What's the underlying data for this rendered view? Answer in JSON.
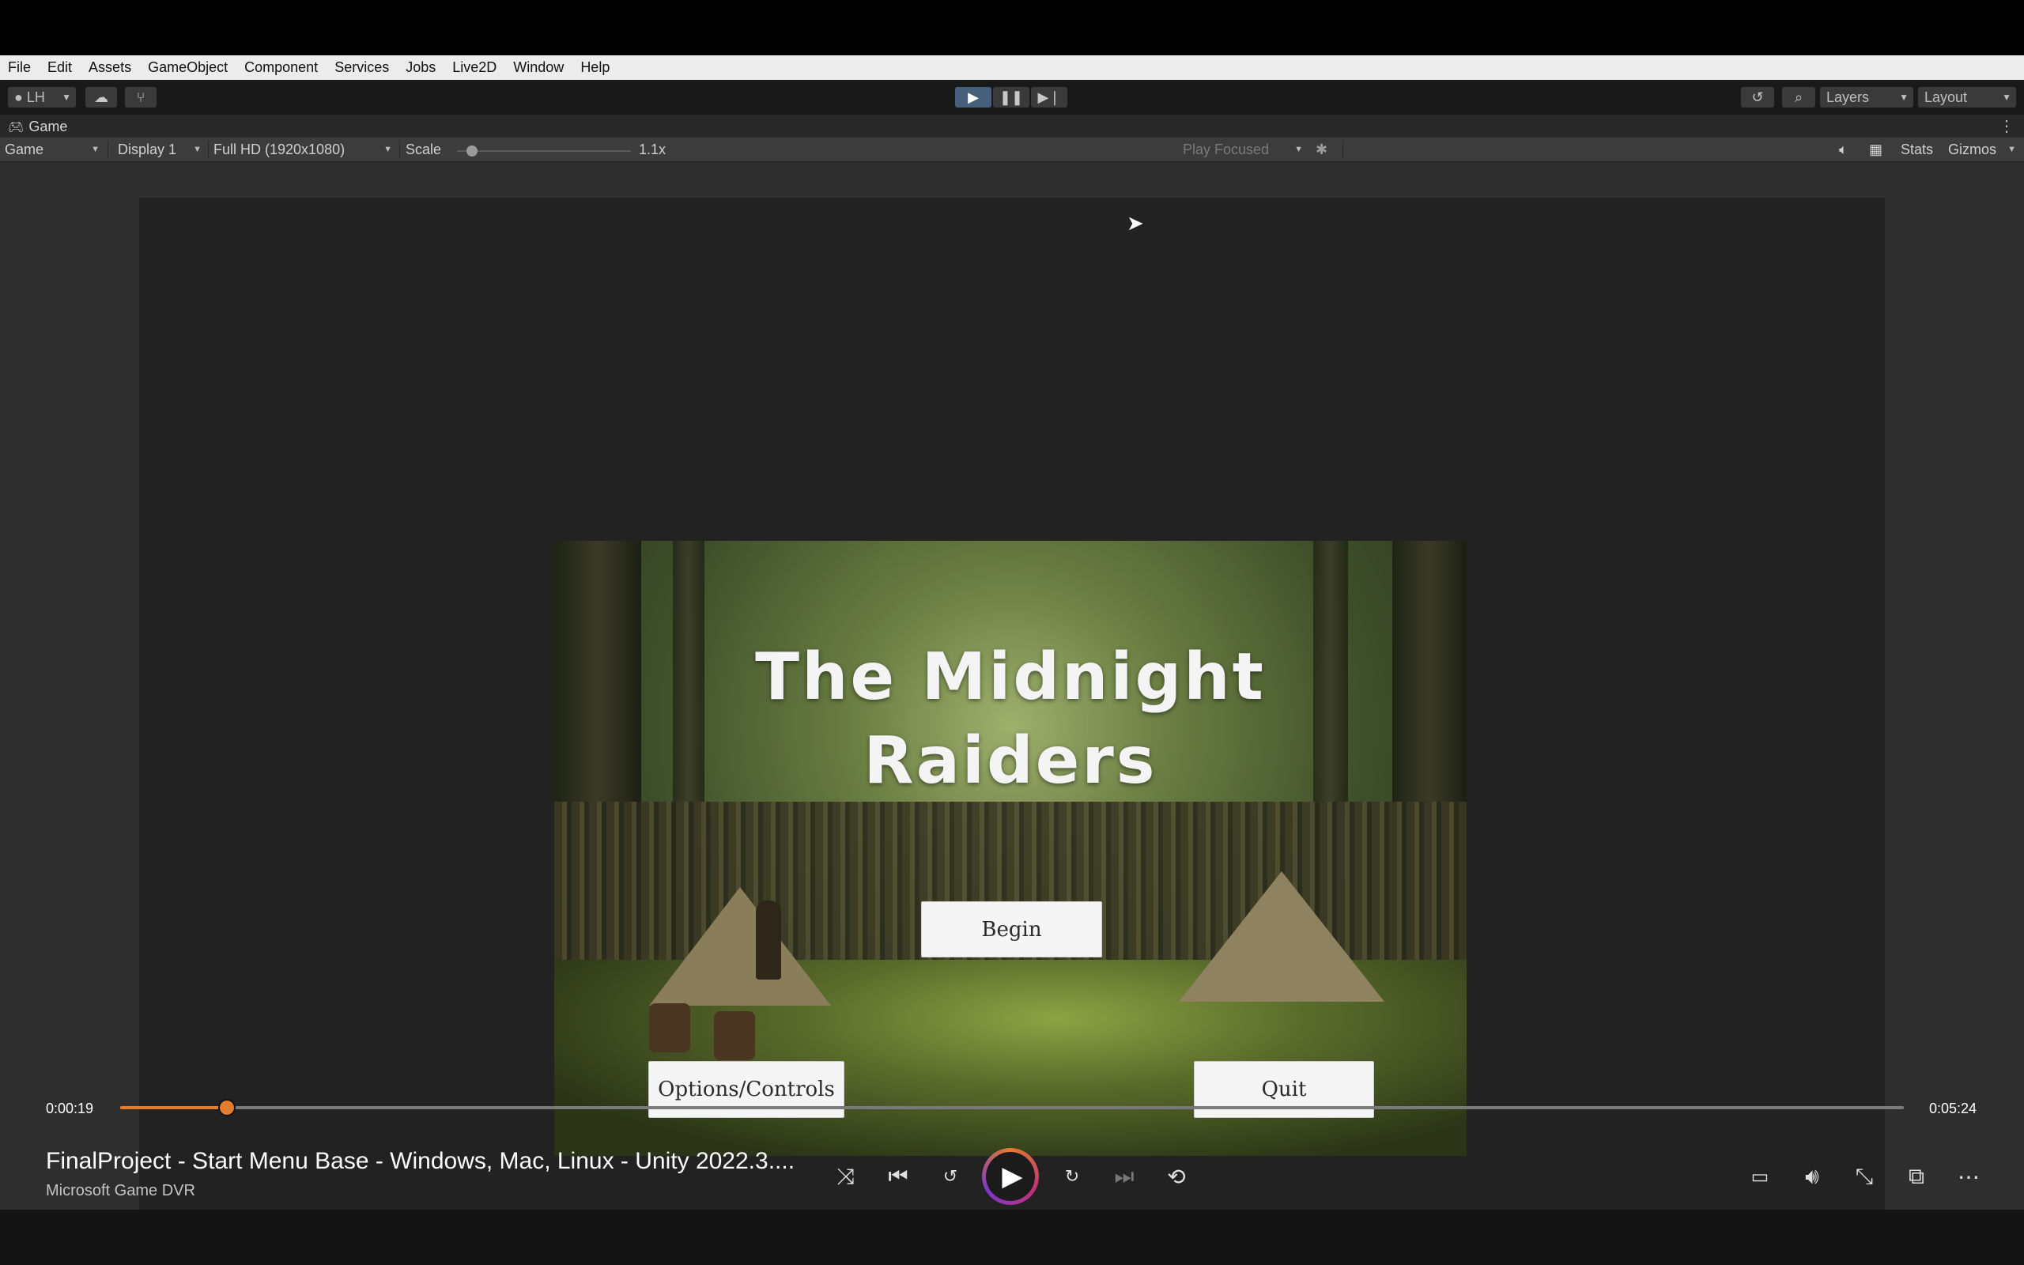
{
  "menu": [
    "File",
    "Edit",
    "Assets",
    "GameObject",
    "Component",
    "Services",
    "Jobs",
    "Live2D",
    "Window",
    "Help"
  ],
  "toolbar": {
    "account_label": "LH",
    "layers_label": "Layers",
    "layout_label": "Layout"
  },
  "game_tab": {
    "label": "Game"
  },
  "game_options": {
    "view_mode": "Game",
    "display": "Display 1",
    "resolution": "Full HD (1920x1080)",
    "scale_label": "Scale",
    "scale_value": "1.1x",
    "play_mode": "Play Focused",
    "stats_label": "Stats",
    "gizmos_label": "Gizmos"
  },
  "game": {
    "title_line1": "The Midnight",
    "title_line2": "Raiders",
    "begin_label": "Begin",
    "options_label": "Options/Controls",
    "quit_label": "Quit"
  },
  "player": {
    "current_time": "0:00:19",
    "total_time": "0:05:24",
    "progress": 0.06,
    "title": "FinalProject - Start Menu Base - Windows, Mac, Linux - Unity 2022.3....",
    "source": "Microsoft Game DVR"
  },
  "colors": {
    "accent": "#e37c2c",
    "play_active": "#46607c"
  }
}
